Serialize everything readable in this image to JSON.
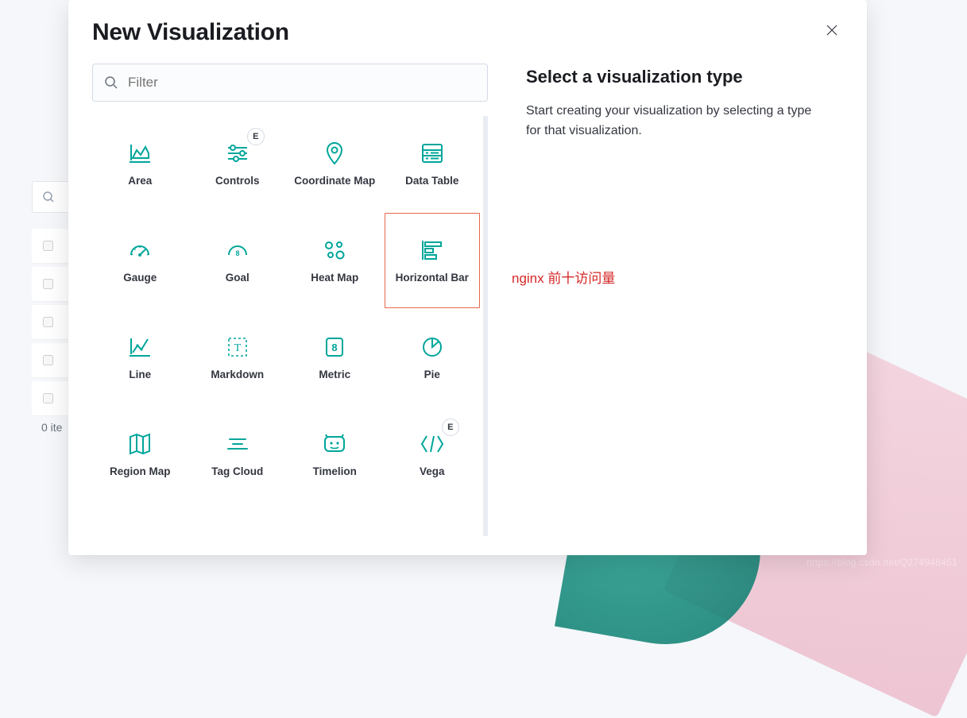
{
  "background": {
    "items_count_label": "0 ite"
  },
  "modal": {
    "title": "New Visualization",
    "filter": {
      "placeholder": "Filter"
    },
    "selected_index": 7,
    "viz": [
      {
        "id": "area",
        "label": "Area"
      },
      {
        "id": "controls",
        "label": "Controls",
        "badge": "E"
      },
      {
        "id": "coordinate-map",
        "label": "Coordinate Map"
      },
      {
        "id": "data-table",
        "label": "Data Table"
      },
      {
        "id": "gauge",
        "label": "Gauge"
      },
      {
        "id": "goal",
        "label": "Goal"
      },
      {
        "id": "heat-map",
        "label": "Heat Map"
      },
      {
        "id": "horizontal-bar",
        "label": "Horizontal Bar"
      },
      {
        "id": "line",
        "label": "Line"
      },
      {
        "id": "markdown",
        "label": "Markdown"
      },
      {
        "id": "metric",
        "label": "Metric"
      },
      {
        "id": "pie",
        "label": "Pie"
      },
      {
        "id": "region-map",
        "label": "Region Map"
      },
      {
        "id": "tag-cloud",
        "label": "Tag Cloud"
      },
      {
        "id": "timelion",
        "label": "Timelion"
      },
      {
        "id": "vega",
        "label": "Vega",
        "badge": "E"
      }
    ],
    "right": {
      "title": "Select a visualization type",
      "description": "Start creating your visualization by selecting a type for that visualization."
    },
    "annotation": "nginx 前十访问量"
  },
  "watermark": "https://blog.csdn.net/Q274948451",
  "colors": {
    "accent": "#00a69b",
    "select_border": "#e7664c",
    "annotation": "#d62727"
  }
}
